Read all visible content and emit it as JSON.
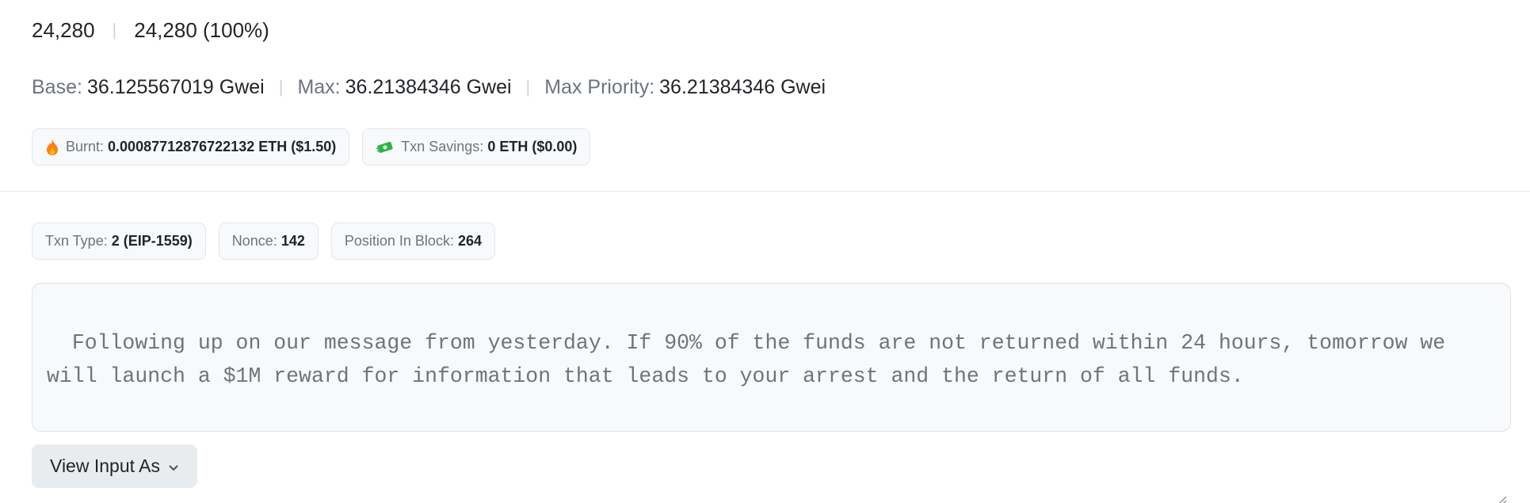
{
  "gas": {
    "limit": "24,280",
    "used": "24,280 (100%)"
  },
  "fees": {
    "base_label": "Base:",
    "base_value": "36.125567019 Gwei",
    "max_label": "Max:",
    "max_value": "36.21384346 Gwei",
    "priority_label": "Max Priority:",
    "priority_value": "36.21384346 Gwei"
  },
  "burnt": {
    "icon": "fire-icon",
    "label": "Burnt:",
    "value": "0.00087712876722132 ETH ($1.50)"
  },
  "savings": {
    "icon": "money-icon",
    "label": "Txn Savings:",
    "value": "0 ETH ($0.00)"
  },
  "txn": {
    "type_label": "Txn Type:",
    "type_value": "2 (EIP-1559)",
    "nonce_label": "Nonce:",
    "nonce_value": "142",
    "position_label": "Position In Block:",
    "position_value": "264"
  },
  "input_data": "Following up on our message from yesterday. If 90% of the funds are not returned within 24 hours, tomorrow we will launch a $1M reward for information that leads to your arrest and the return of all funds.",
  "view_input_button": "View Input As",
  "colors": {
    "badge_bg": "#f8f9fa",
    "muted_text": "#6c757d",
    "fire": "#fd7e14",
    "money": "#2fb344"
  }
}
